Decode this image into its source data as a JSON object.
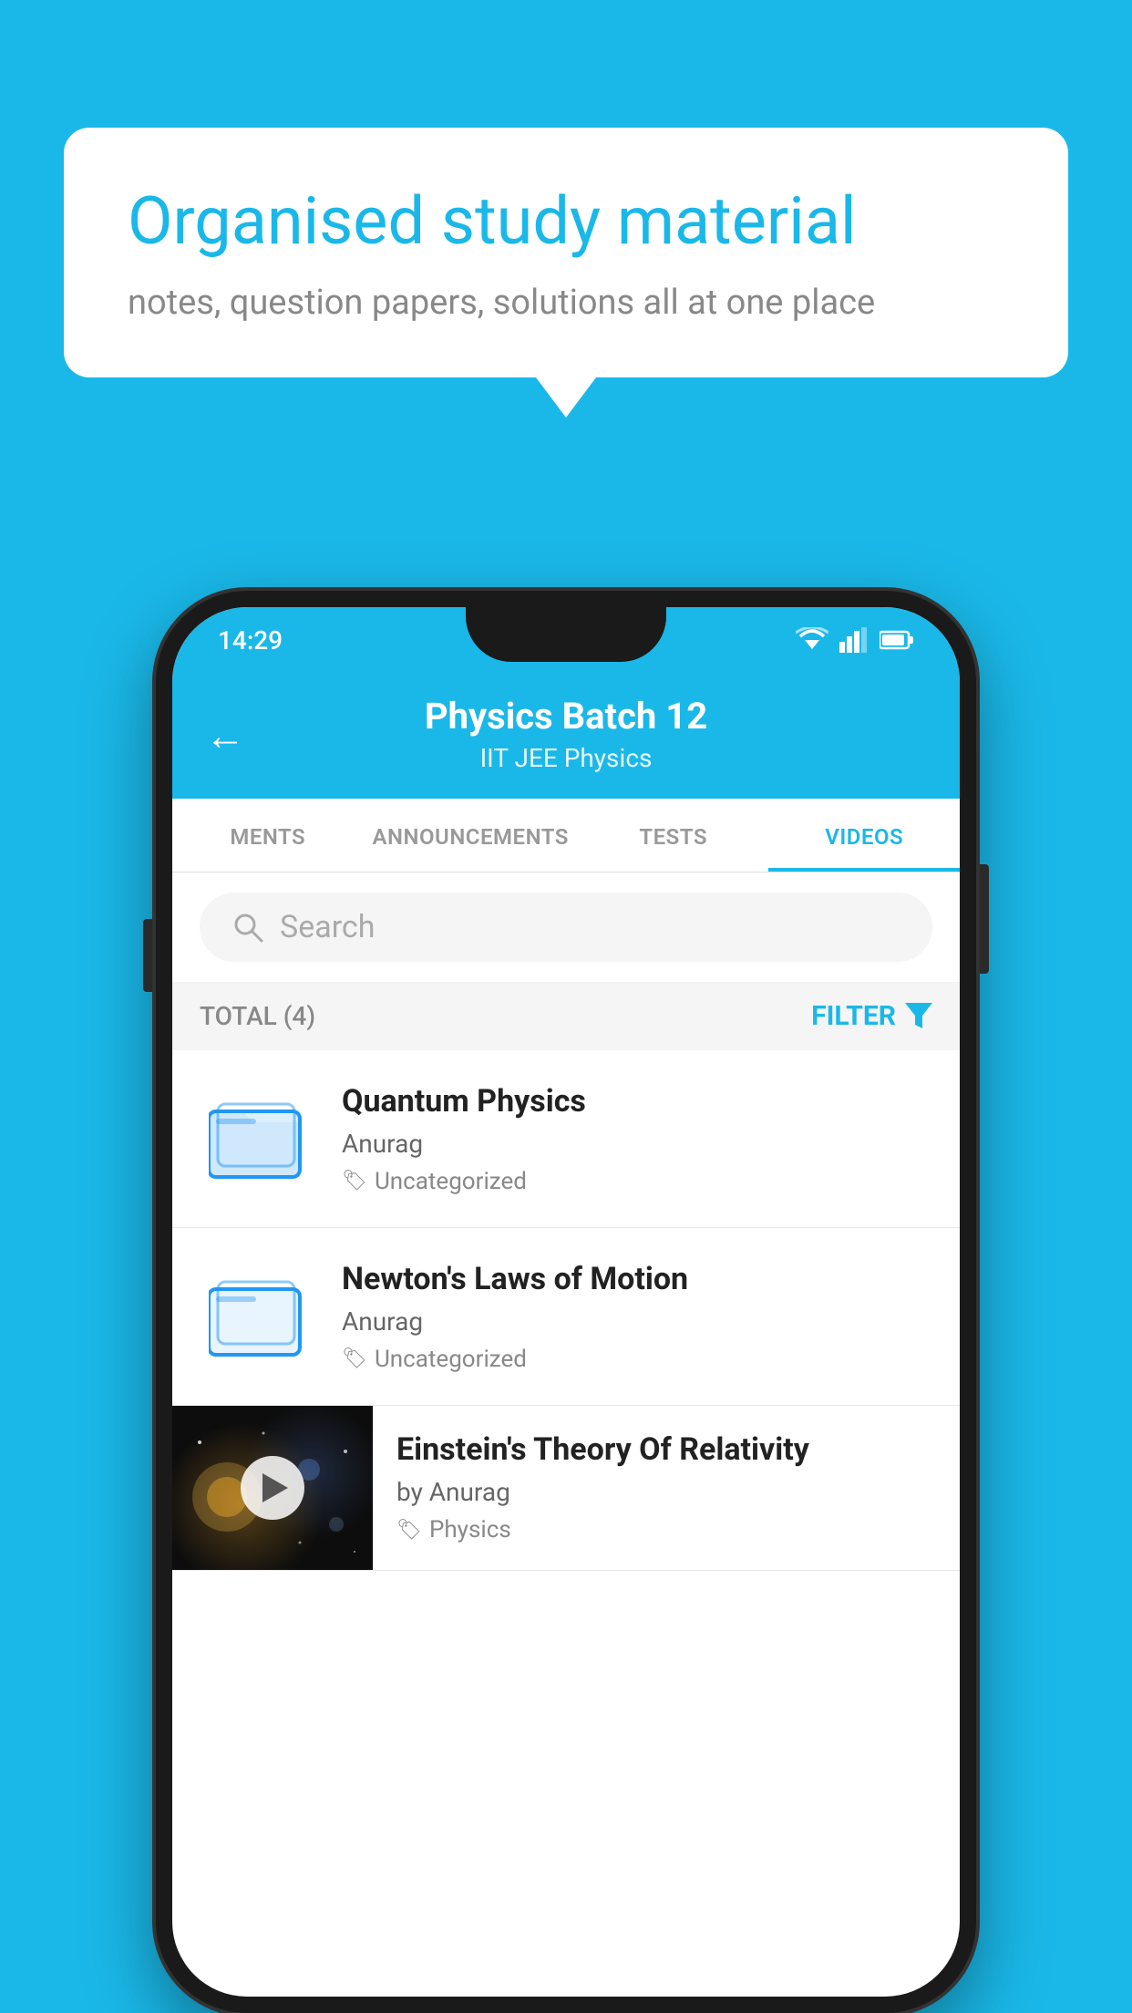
{
  "background": {
    "color": "#1ab8e8"
  },
  "speech_bubble": {
    "title": "Organised study material",
    "subtitle": "notes, question papers, solutions all at one place"
  },
  "phone": {
    "status_bar": {
      "time": "14:29"
    },
    "header": {
      "title": "Physics Batch 12",
      "subtitle": "IIT JEE   Physics",
      "back_label": "←"
    },
    "tabs": [
      {
        "label": "MENTS",
        "active": false
      },
      {
        "label": "ANNOUNCEMENTS",
        "active": false
      },
      {
        "label": "TESTS",
        "active": false
      },
      {
        "label": "VIDEOS",
        "active": true
      }
    ],
    "search": {
      "placeholder": "Search"
    },
    "filter_row": {
      "total_label": "TOTAL (4)",
      "filter_label": "FILTER"
    },
    "videos": [
      {
        "title": "Quantum Physics",
        "author": "Anurag",
        "tag": "Uncategorized",
        "has_thumb": false
      },
      {
        "title": "Newton's Laws of Motion",
        "author": "Anurag",
        "tag": "Uncategorized",
        "has_thumb": false
      },
      {
        "title": "Einstein's Theory Of Relativity",
        "author": "by Anurag",
        "tag": "Physics",
        "has_thumb": true
      }
    ]
  }
}
